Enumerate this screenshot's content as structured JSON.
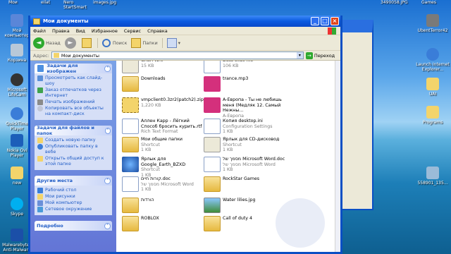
{
  "desktop": {
    "top_labels": [
      "Мои",
      "eilat",
      "Nero StartSmart",
      "images.jpg",
      "3490058.JPG",
      "Games"
    ],
    "left_icons": [
      "Мой компьютер",
      "Корзина",
      "Microsoft LifeCam",
      "QuickTime Player",
      "Nokia Ovi Player",
      "new",
      "Skype",
      "Malwarebytes Anti-Malware"
    ],
    "right_icons": [
      "UbentTerror42",
      "Launch Internet Explorer...",
      "UAI",
      "Programs",
      "558901_135..."
    ]
  },
  "window": {
    "title": "Мои документы",
    "menu": [
      "Файл",
      "Правка",
      "Вид",
      "Избранное",
      "Сервис",
      "Справка"
    ],
    "toolbar": {
      "back": "Назад",
      "search": "Поиск",
      "folders": "Папки"
    },
    "address": {
      "label": "Адрес:",
      "value": "Мои документы",
      "go": "Переход"
    }
  },
  "sidebar": {
    "panels": [
      {
        "title": "Задачи для изображен",
        "items": [
          "Просмотреть как слайд-шоу",
          "Заказ отпечатков через Интернет",
          "Печать изображений",
          "Копировать все объекты на компакт-диск"
        ]
      },
      {
        "title": "Задачи для файлов и папок",
        "items": [
          "Создать новую папку",
          "Опубликовать папку в вебе",
          "Открыть общий доступ к этой папке"
        ]
      },
      {
        "title": "Другие места",
        "items": [
          "Рабочий стол",
          "Мои рисунки",
          "Мой компьютер",
          "Сетевое окружение"
        ]
      },
      {
        "title": "Подробно",
        "items": []
      }
    ]
  },
  "files": [
    {
      "name": "Gnari WAP",
      "sub": "15 KB",
      "kind": "shortcut"
    },
    {
      "name": "Data slide file",
      "sub": "106 KB",
      "kind": "doc"
    },
    {
      "name": "Downloads",
      "sub": "",
      "kind": "folder"
    },
    {
      "name": "trance.mp3",
      "sub": "",
      "kind": "audio"
    },
    {
      "name": "vmpclient0.3zr2(patch2).zip",
      "sub": "1,220 KB",
      "kind": "zip"
    },
    {
      "name": "A-Европа - Ты не любишь меня (Медляк 12. Самый Нежны...",
      "sub": "A-Европа",
      "kind": "audio"
    },
    {
      "name": "Аллен Карр - Лёгкий Способ бросить курить.rtf",
      "sub": "Rich Text Format",
      "kind": "doc"
    },
    {
      "name": "Копия desktop.ini",
      "sub": "Configuration Settings",
      "sub2": "1 KB",
      "kind": "doc"
    },
    {
      "name": "Мои общие папки",
      "sub": "Shortcut",
      "sub2": "1 KB",
      "kind": "folder"
    },
    {
      "name": "Ярлык для CD-дисковод",
      "sub": "Shortcut",
      "sub2": "1 KB",
      "kind": "shortcut"
    },
    {
      "name": "Ярлык для Google_Earth_BZXD",
      "sub": "Shortcut",
      "sub2": "1 KB",
      "kind": "earth"
    },
    {
      "name": "מסמך של Microsoft Word.doc",
      "sub": "מסמך של Microsoft Word",
      "sub2": "1 KB",
      "kind": "doc"
    },
    {
      "name": "קורות חיים.doc",
      "sub": "מסמך של Microsoft Word",
      "sub2": "1 KB",
      "kind": "doc"
    },
    {
      "name": "RockStar Games",
      "sub": "",
      "kind": "folder"
    },
    {
      "name": "הורדות",
      "sub": "",
      "kind": "folder"
    },
    {
      "name": "Water lilies.jpg",
      "sub": "",
      "kind": "image"
    },
    {
      "name": "ROBLOX",
      "sub": "",
      "kind": "folder"
    },
    {
      "name": "Call of duty 4",
      "sub": "",
      "kind": "folder"
    }
  ]
}
